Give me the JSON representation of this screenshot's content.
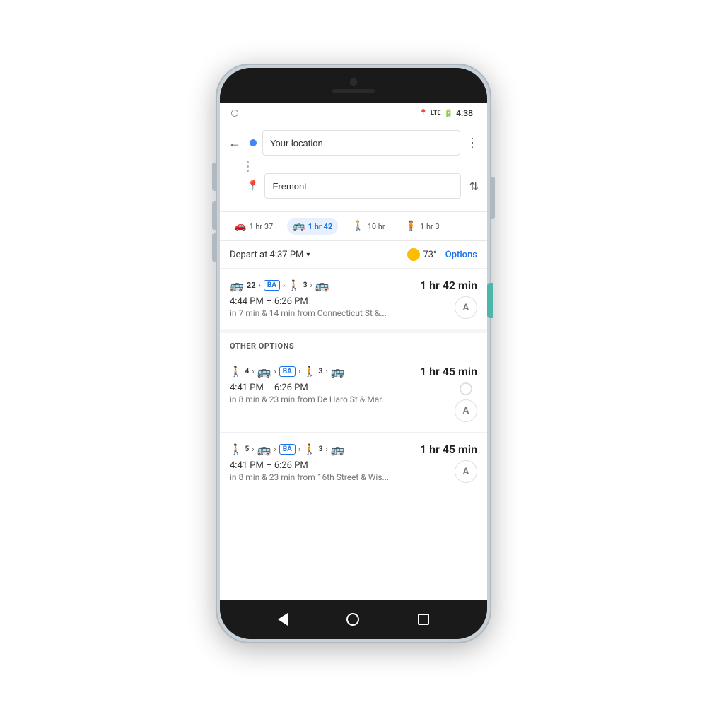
{
  "status_bar": {
    "time": "4:38",
    "icons": [
      "location",
      "lte",
      "battery"
    ]
  },
  "search": {
    "origin_placeholder": "Your location",
    "destination_placeholder": "Fremont"
  },
  "transport_tabs": [
    {
      "id": "car",
      "icon": "🚗",
      "duration": "1 hr 37",
      "active": false
    },
    {
      "id": "transit",
      "icon": "🚌",
      "duration": "1 hr 42",
      "active": true
    },
    {
      "id": "walk",
      "icon": "🚶",
      "duration": "10 hr",
      "active": false
    },
    {
      "id": "ride",
      "icon": "🧍",
      "duration": "1 hr 3",
      "active": false
    }
  ],
  "options_bar": {
    "depart_label": "Depart at 4:37 PM",
    "temperature": "73°",
    "options_label": "Options"
  },
  "primary_route": {
    "icons": [
      "bus_22",
      "bart",
      "walk_3",
      "bus"
    ],
    "duration": "1 hr 42 min",
    "time_range": "4:44 PM – 6:26 PM",
    "detail": "in 7 min & 14 min from Connecticut St &...",
    "avatar": "A"
  },
  "other_options_label": "OTHER OPTIONS",
  "other_routes": [
    {
      "icons": [
        "walk_4",
        "bus",
        "bart",
        "walk_3",
        "bus"
      ],
      "duration": "1 hr 45 min",
      "time_range": "4:41 PM – 6:26 PM",
      "detail": "in 8 min & 23 min from De Haro St & Mar...",
      "avatar": "A"
    },
    {
      "icons": [
        "walk_5",
        "bus",
        "bart",
        "walk_3",
        "bus"
      ],
      "duration": "1 hr 45 min",
      "time_range": "4:41 PM – 6:26 PM",
      "detail": "in 8 min & 23 min from 16th Street & Wis...",
      "avatar": "A"
    }
  ],
  "nav_buttons": {
    "back": "◀",
    "home": "●",
    "recent": "■"
  }
}
